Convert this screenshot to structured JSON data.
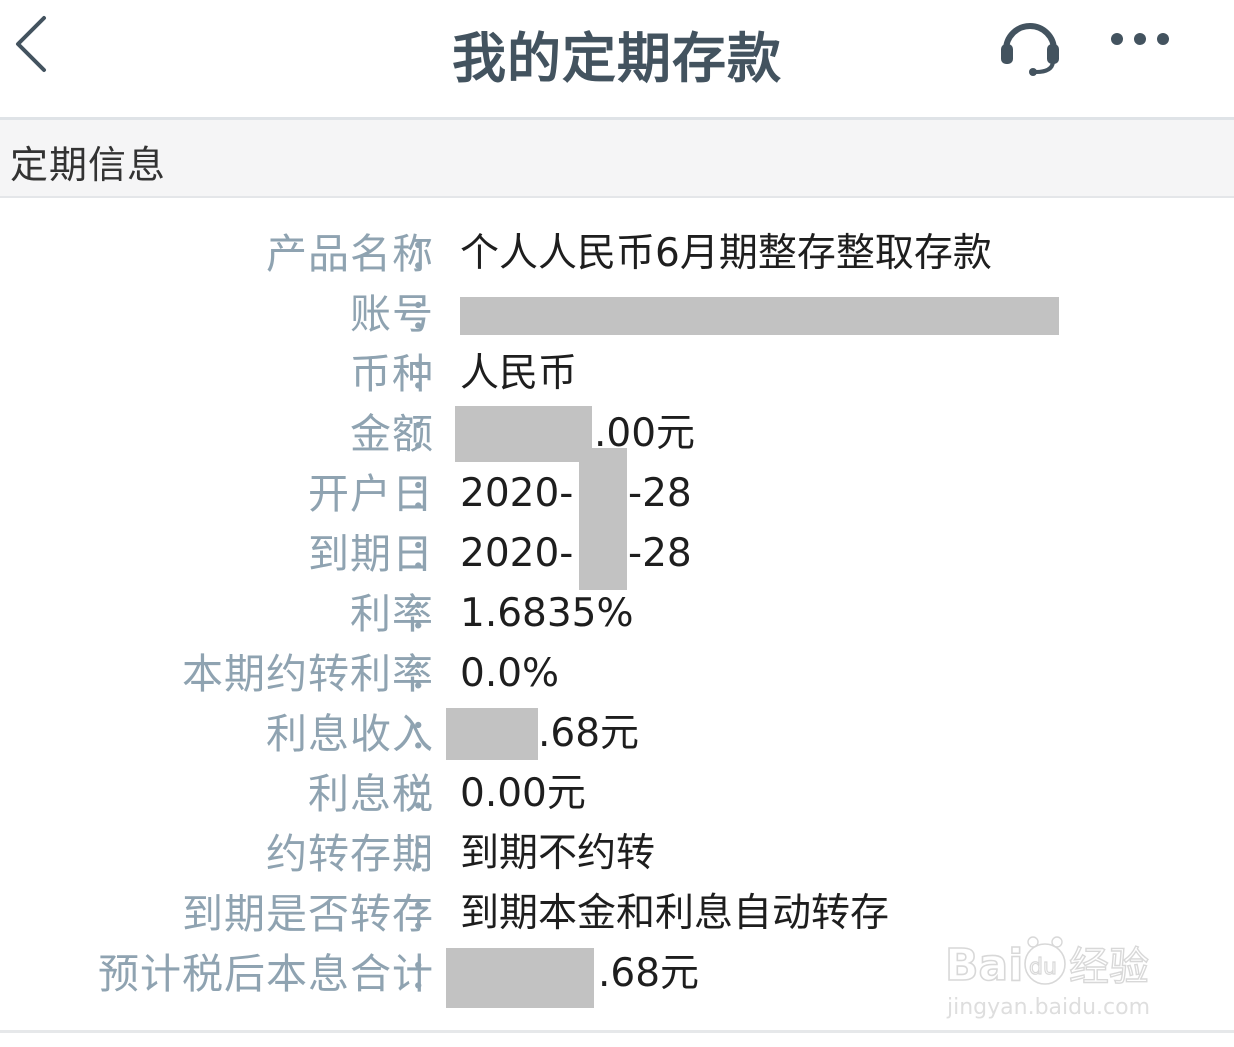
{
  "header": {
    "title": "我的定期存款",
    "back_icon": "chevron-left-icon",
    "support_icon": "headset-icon",
    "more_icon": "more-dots-icon"
  },
  "section": {
    "title": "定期信息"
  },
  "fields": {
    "product_name": {
      "label": "产品名称",
      "value": "个人人民币6月期整存整取存款"
    },
    "account": {
      "label": "账号"
    },
    "currency": {
      "label": "币种",
      "value": "人民币"
    },
    "amount": {
      "label": "金额",
      "suffix": ".00元"
    },
    "open_date": {
      "label": "开户日",
      "prefix": "2020-",
      "suffix": "-28"
    },
    "maturity_date": {
      "label": "到期日",
      "prefix": "2020-",
      "suffix": "-28"
    },
    "rate": {
      "label": "利率",
      "value": "1.6835%"
    },
    "rollover_rate": {
      "label": "本期约转利率",
      "value": "0.0%"
    },
    "interest_income": {
      "label": "利息收入",
      "suffix": ".68元"
    },
    "interest_tax": {
      "label": "利息税",
      "value": "0.00元"
    },
    "rollover_term": {
      "label": "约转存期",
      "value": "到期不约转"
    },
    "auto_rollover": {
      "label": "到期是否转存",
      "value": "到期本金和利息自动转存"
    },
    "total_after_tax": {
      "label": "预计税后本息合计",
      "suffix": ".68元"
    }
  },
  "colon": "：",
  "watermark": {
    "brand": "Baidu经验",
    "url": "jingyan.baidu.com"
  },
  "colors": {
    "title": "#43535f",
    "label": "#8fa3b1",
    "value": "#1e1e1e",
    "redaction": "#c2c2c2"
  }
}
